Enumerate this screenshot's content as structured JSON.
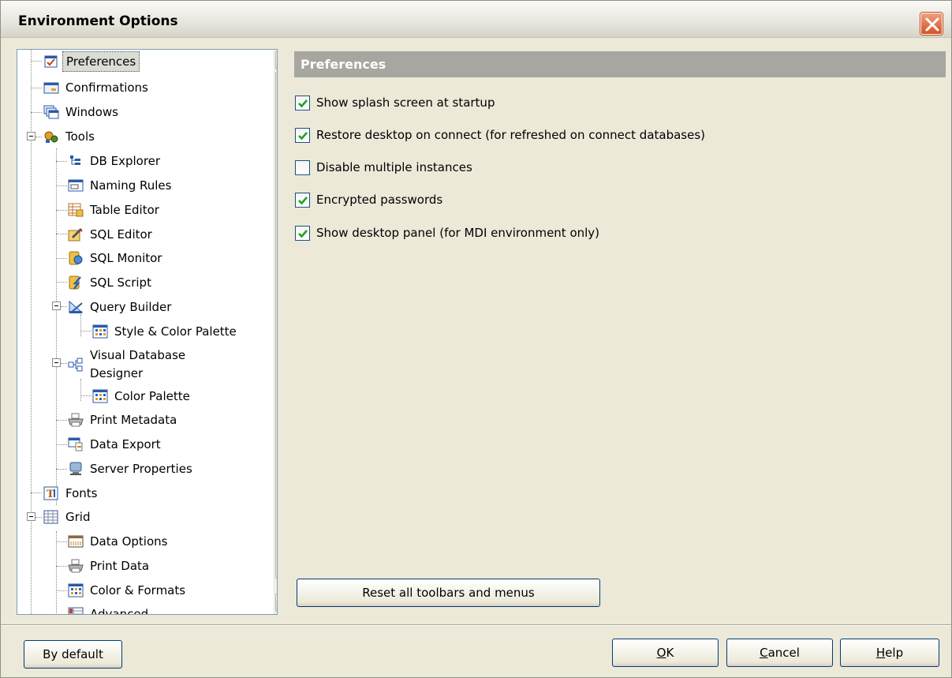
{
  "window": {
    "title": "Environment Options"
  },
  "tree": {
    "items": [
      {
        "label": "Preferences",
        "icon": "preferences-icon"
      },
      {
        "label": "Confirmations",
        "icon": "confirmations-icon"
      },
      {
        "label": "Windows",
        "icon": "windows-icon"
      },
      {
        "label": "Tools",
        "icon": "tools-icon"
      },
      {
        "label": "DB Explorer",
        "icon": "db-explorer-icon"
      },
      {
        "label": "Naming Rules",
        "icon": "naming-rules-icon"
      },
      {
        "label": "Table Editor",
        "icon": "table-editor-icon"
      },
      {
        "label": "SQL Editor",
        "icon": "sql-editor-icon"
      },
      {
        "label": "SQL Monitor",
        "icon": "sql-monitor-icon"
      },
      {
        "label": "SQL Script",
        "icon": "sql-script-icon"
      },
      {
        "label": "Query Builder",
        "icon": "query-builder-icon"
      },
      {
        "label": "Style & Color Palette",
        "icon": "palette-icon"
      },
      {
        "label": "Visual Database",
        "icon": "visual-designer-icon"
      },
      {
        "label": "Designer",
        "icon": ""
      },
      {
        "label": "Color Palette",
        "icon": "palette-icon"
      },
      {
        "label": "Print Metadata",
        "icon": "printer-icon"
      },
      {
        "label": "Data Export",
        "icon": "data-export-icon"
      },
      {
        "label": "Server Properties",
        "icon": "server-icon"
      },
      {
        "label": "Fonts",
        "icon": "fonts-icon"
      },
      {
        "label": "Grid",
        "icon": "grid-icon"
      },
      {
        "label": "Data Options",
        "icon": "data-options-icon"
      },
      {
        "label": "Print Data",
        "icon": "printer-icon"
      },
      {
        "label": "Color & Formats",
        "icon": "palette-icon"
      },
      {
        "label": "Advanced",
        "icon": "advanced-icon"
      }
    ],
    "selected": "Preferences"
  },
  "panel": {
    "header": "Preferences",
    "options": [
      {
        "label": "Show splash screen at startup",
        "checked": true
      },
      {
        "label": "Restore desktop on connect (for refreshed on connect databases)",
        "checked": true
      },
      {
        "label": "Disable multiple instances",
        "checked": false
      },
      {
        "label": "Encrypted passwords",
        "checked": true
      },
      {
        "label": "Show desktop panel (for MDI environment only)",
        "checked": true
      }
    ],
    "reset_button": "Reset all toolbars and menus"
  },
  "footer": {
    "by_default": "By default",
    "ok_accel": "O",
    "ok_rest": "K",
    "cancel_accel": "C",
    "cancel_rest": "ancel",
    "help_accel": "H",
    "help_rest": "elp"
  },
  "colors": {
    "window_bg": "#ece9d8",
    "header_bg": "#a7a6a0",
    "close_button": "#d2532a",
    "checkbox_mark": "#21a121"
  }
}
